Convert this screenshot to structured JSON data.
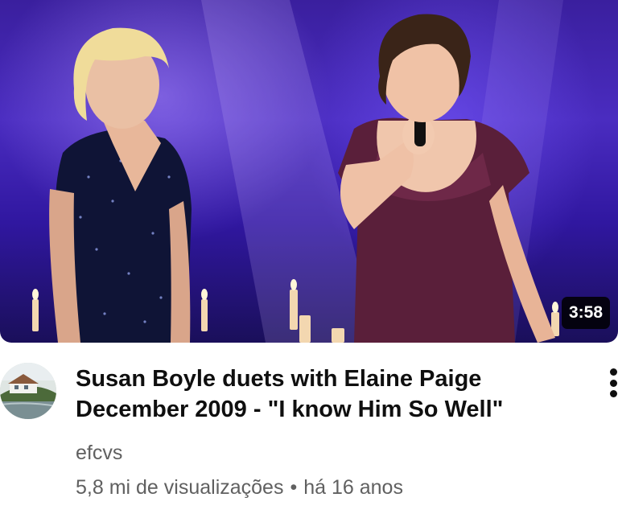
{
  "video": {
    "duration": "3:58",
    "title_line1": "Susan Boyle duets with Elaine Paige",
    "title_line2": "December 2009 - \"I know Him So Well\"",
    "channel": "efcvs",
    "views": "5,8 mi de visualizações",
    "separator": "•",
    "age": "há 16 anos"
  },
  "icons": {
    "more": "more-vertical-icon"
  }
}
